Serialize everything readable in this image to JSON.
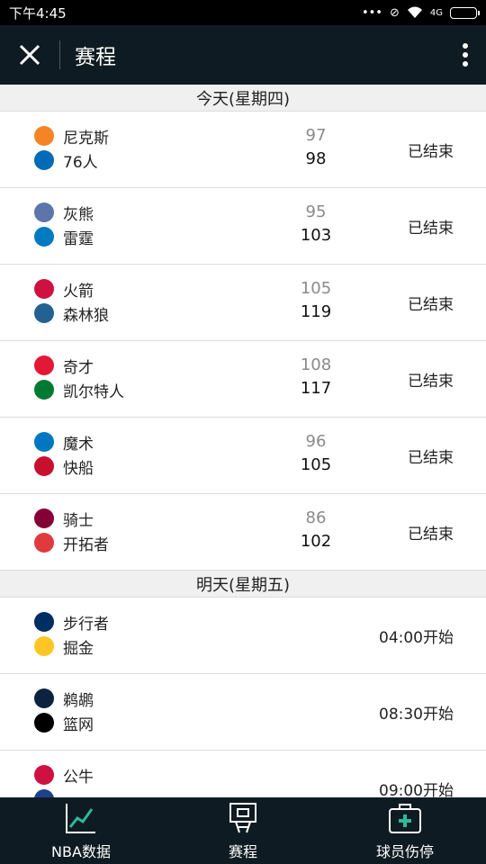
{
  "status_bar": {
    "time": "下午4:45",
    "network": "4G",
    "dots": "•••"
  },
  "header": {
    "title": "赛程"
  },
  "colors": {
    "header_bg": "#0f1b22",
    "row_bg": "#ffffff",
    "section_bg": "#f0f0f0",
    "loser_score": "#8a8a8a"
  },
  "sections": [
    {
      "title": "今天(星期四)",
      "games": [
        {
          "home": "尼克斯",
          "home_logo": "knicks-logo",
          "home_color": "#f58426",
          "home_score": "97",
          "away": "76人",
          "away_logo": "sixers-logo",
          "away_color": "#006bb6",
          "away_score": "98",
          "status": "已结束"
        },
        {
          "home": "灰熊",
          "home_logo": "grizzlies-logo",
          "home_color": "#5d76a9",
          "home_score": "95",
          "away": "雷霆",
          "away_logo": "thunder-logo",
          "away_color": "#007ac1",
          "away_score": "103",
          "status": "已结束"
        },
        {
          "home": "火箭",
          "home_logo": "rockets-logo",
          "home_color": "#ce1141",
          "home_score": "105",
          "away": "森林狼",
          "away_logo": "timberwolves-logo",
          "away_color": "#236192",
          "away_score": "119",
          "status": "已结束"
        },
        {
          "home": "奇才",
          "home_logo": "wizards-logo",
          "home_color": "#e31837",
          "home_score": "108",
          "away": "凯尔特人",
          "away_logo": "celtics-logo",
          "away_color": "#007a33",
          "away_score": "117",
          "status": "已结束"
        },
        {
          "home": "魔术",
          "home_logo": "magic-logo",
          "home_color": "#0077c0",
          "home_score": "96",
          "away": "快船",
          "away_logo": "clippers-logo",
          "away_color": "#c8102e",
          "away_score": "105",
          "status": "已结束"
        },
        {
          "home": "骑士",
          "home_logo": "cavaliers-logo",
          "home_color": "#860038",
          "home_score": "86",
          "away": "开拓者",
          "away_logo": "blazers-logo",
          "away_color": "#e03a3e",
          "away_score": "102",
          "status": "已结束"
        }
      ]
    },
    {
      "title": "明天(星期五)",
      "games": [
        {
          "home": "步行者",
          "home_logo": "pacers-logo",
          "home_color": "#002d62",
          "home_score": "",
          "away": "掘金",
          "away_logo": "nuggets-logo",
          "away_color": "#fec524",
          "away_score": "",
          "status": "04:00开始"
        },
        {
          "home": "鹈鹕",
          "home_logo": "pelicans-logo",
          "home_color": "#0c2340",
          "home_score": "",
          "away": "篮网",
          "away_logo": "nets-logo",
          "away_color": "#000000",
          "away_score": "",
          "status": "08:30开始"
        },
        {
          "home": "公牛",
          "home_logo": "bulls-logo",
          "home_color": "#ce1141",
          "home_score": "",
          "away": "",
          "away_logo": "",
          "away_color": "#1d428a",
          "away_score": "",
          "status": "09:00开始"
        }
      ]
    }
  ],
  "bottom_nav": [
    {
      "label": "NBA数据",
      "icon": "chart-line-icon"
    },
    {
      "label": "赛程",
      "icon": "basketball-hoop-icon"
    },
    {
      "label": "球员伤停",
      "icon": "medical-kit-icon"
    }
  ]
}
